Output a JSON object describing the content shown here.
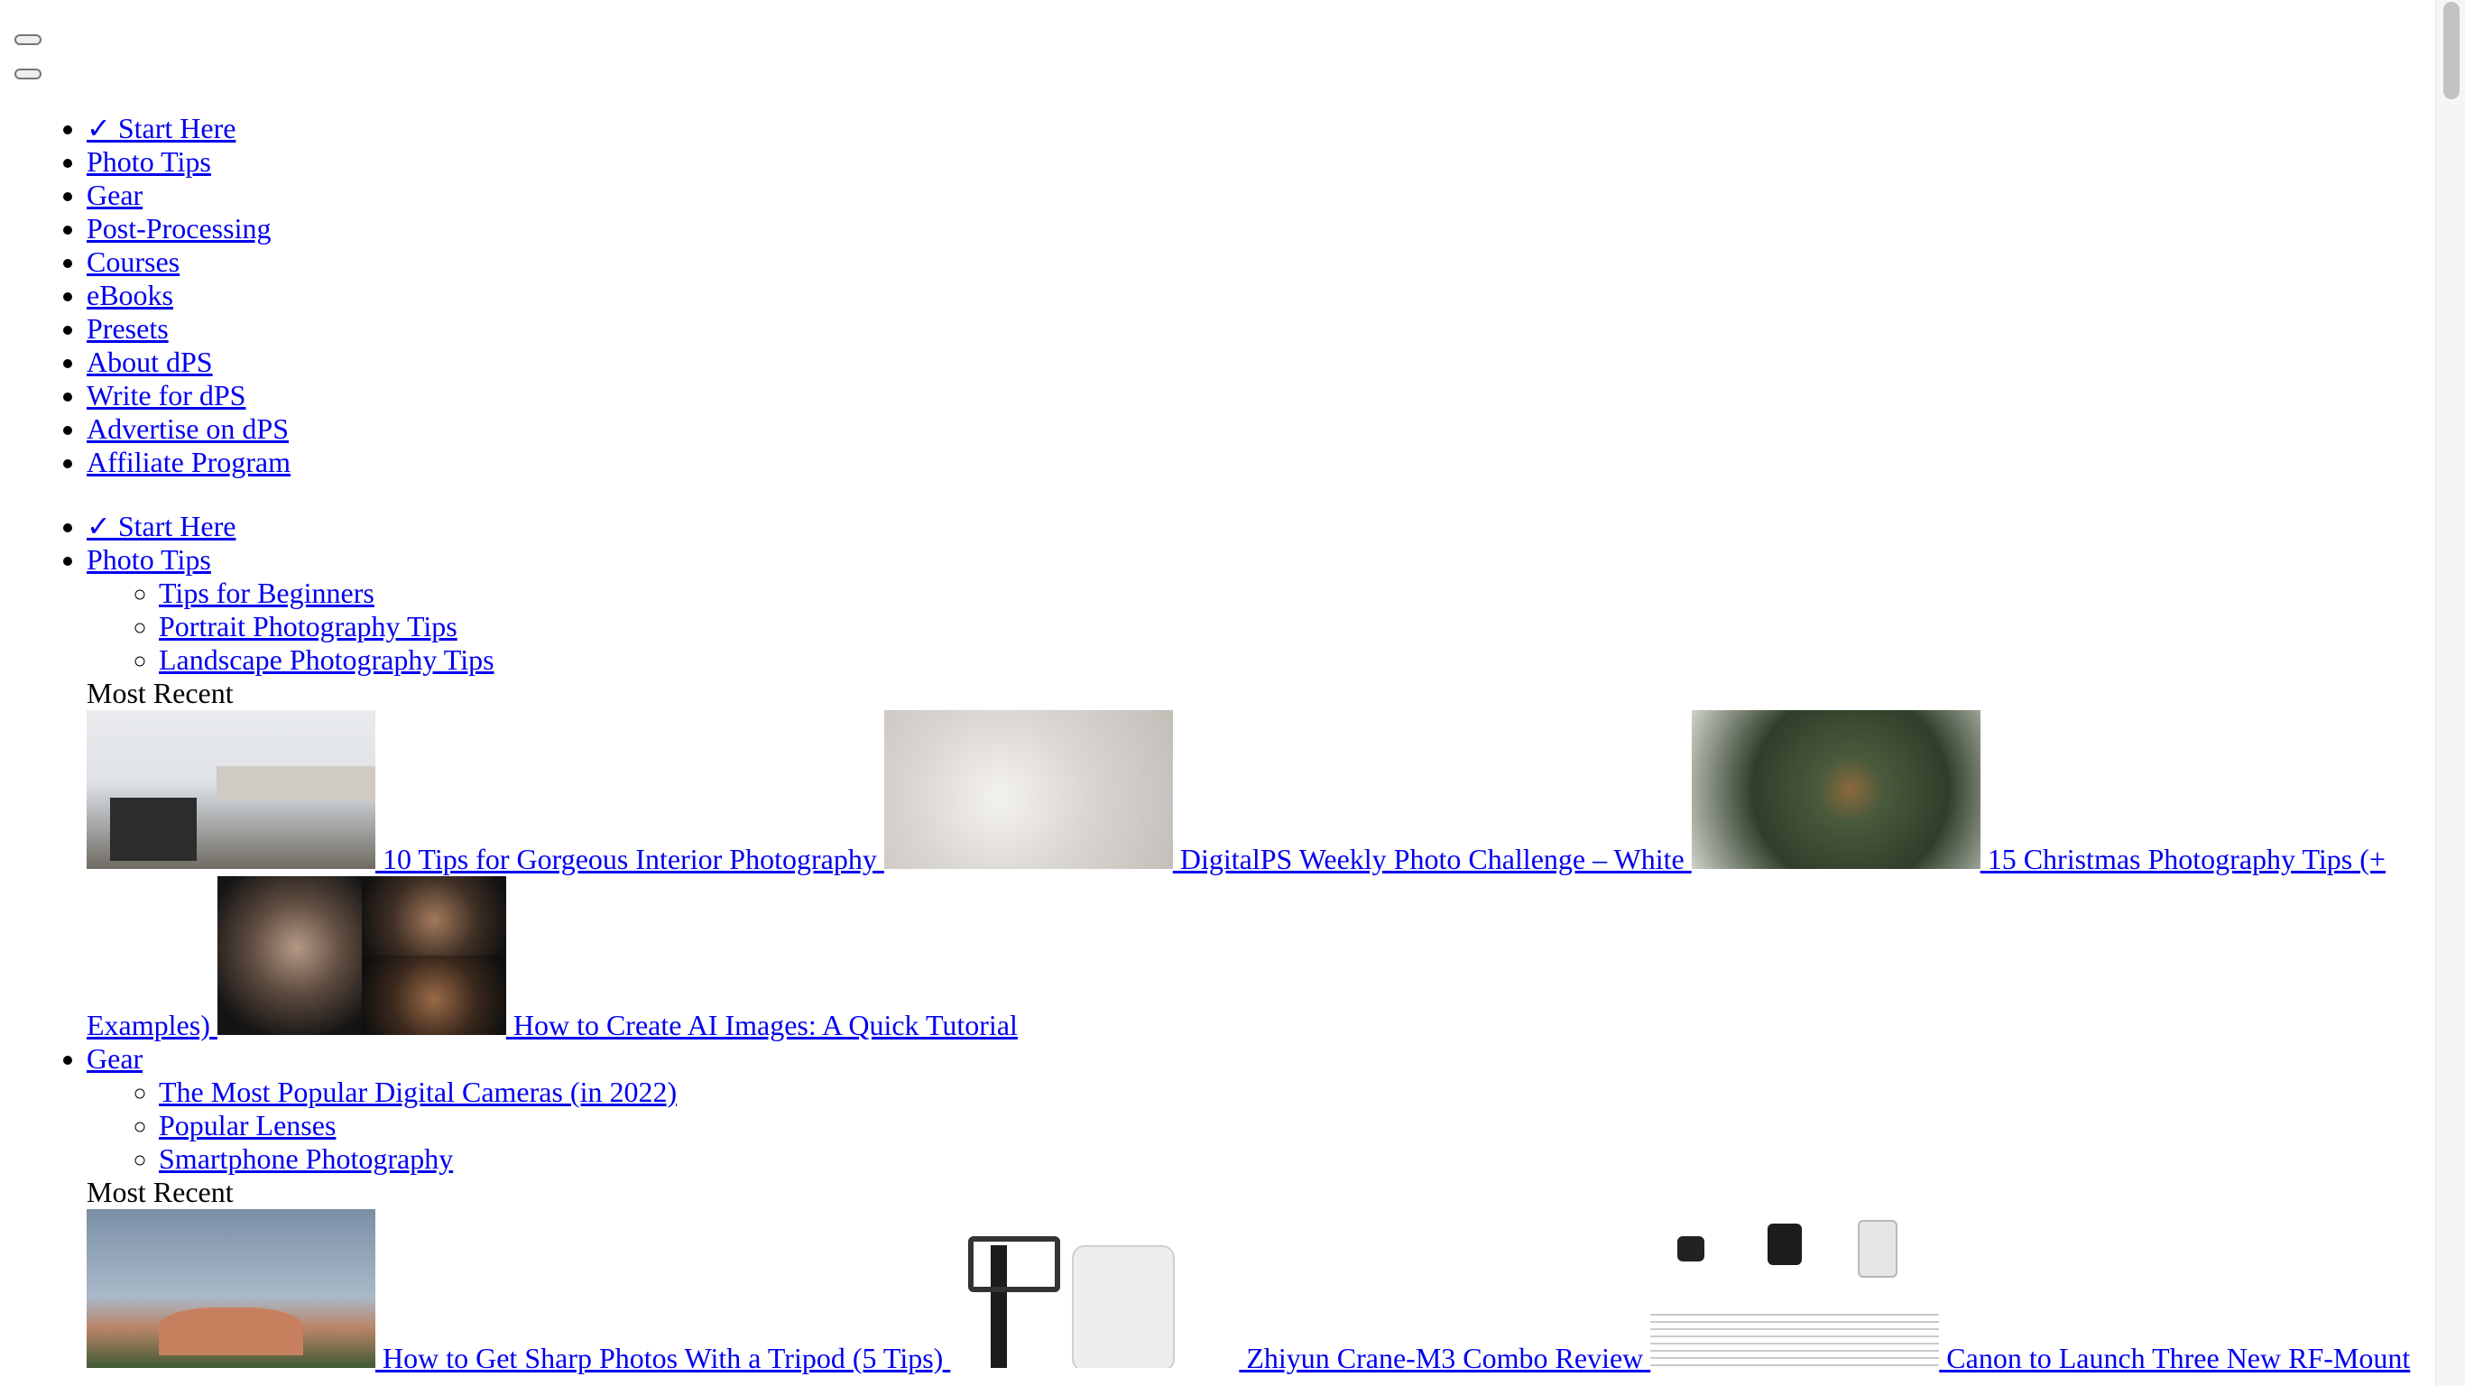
{
  "header": {
    "button_1": "",
    "button_2": ""
  },
  "nav_top": {
    "items": [
      "✓ Start Here",
      "Photo Tips",
      "Gear",
      "Post-Processing",
      "Courses",
      "eBooks",
      "Presets",
      "About dPS",
      "Write for dPS",
      "Advertise on dPS",
      "Affiliate Program"
    ]
  },
  "nav_mega": {
    "start_here": "✓ Start Here",
    "photo_tips": {
      "label": "Photo Tips",
      "sub": [
        "Tips for Beginners",
        "Portrait Photography Tips",
        "Landscape Photography Tips"
      ],
      "most_recent_label": "Most Recent",
      "articles": [
        {
          "title": "10 Tips for Gorgeous Interior Photography",
          "thumb_icon": "interior-kitchen-photo"
        },
        {
          "title": "DigitalPS Weekly Photo Challenge – White",
          "thumb_icon": "white-feather-photo"
        },
        {
          "title": "15 Christmas Photography Tips (+ Examples)",
          "thumb_icon": "christmas-ornament-photo"
        },
        {
          "title": "How to Create AI Images: A Quick Tutorial",
          "thumb_icon": "ai-portraits-photo"
        }
      ]
    },
    "gear": {
      "label": "Gear",
      "sub": [
        "The Most Popular Digital Cameras (in 2022)",
        "Popular Lenses",
        "Smartphone Photography"
      ],
      "most_recent_label": "Most Recent",
      "articles": [
        {
          "title": "How to Get Sharp Photos With a Tripod (5 Tips)",
          "thumb_icon": "palace-palm-trees-photo"
        },
        {
          "title": "Zhiyun Crane-M3 Combo Review",
          "thumb_icon": "gimbal-kit-photo"
        },
        {
          "title": "Canon to Launch Three New RF-Mount",
          "thumb_icon": "canon-lenses-photo"
        }
      ]
    }
  }
}
